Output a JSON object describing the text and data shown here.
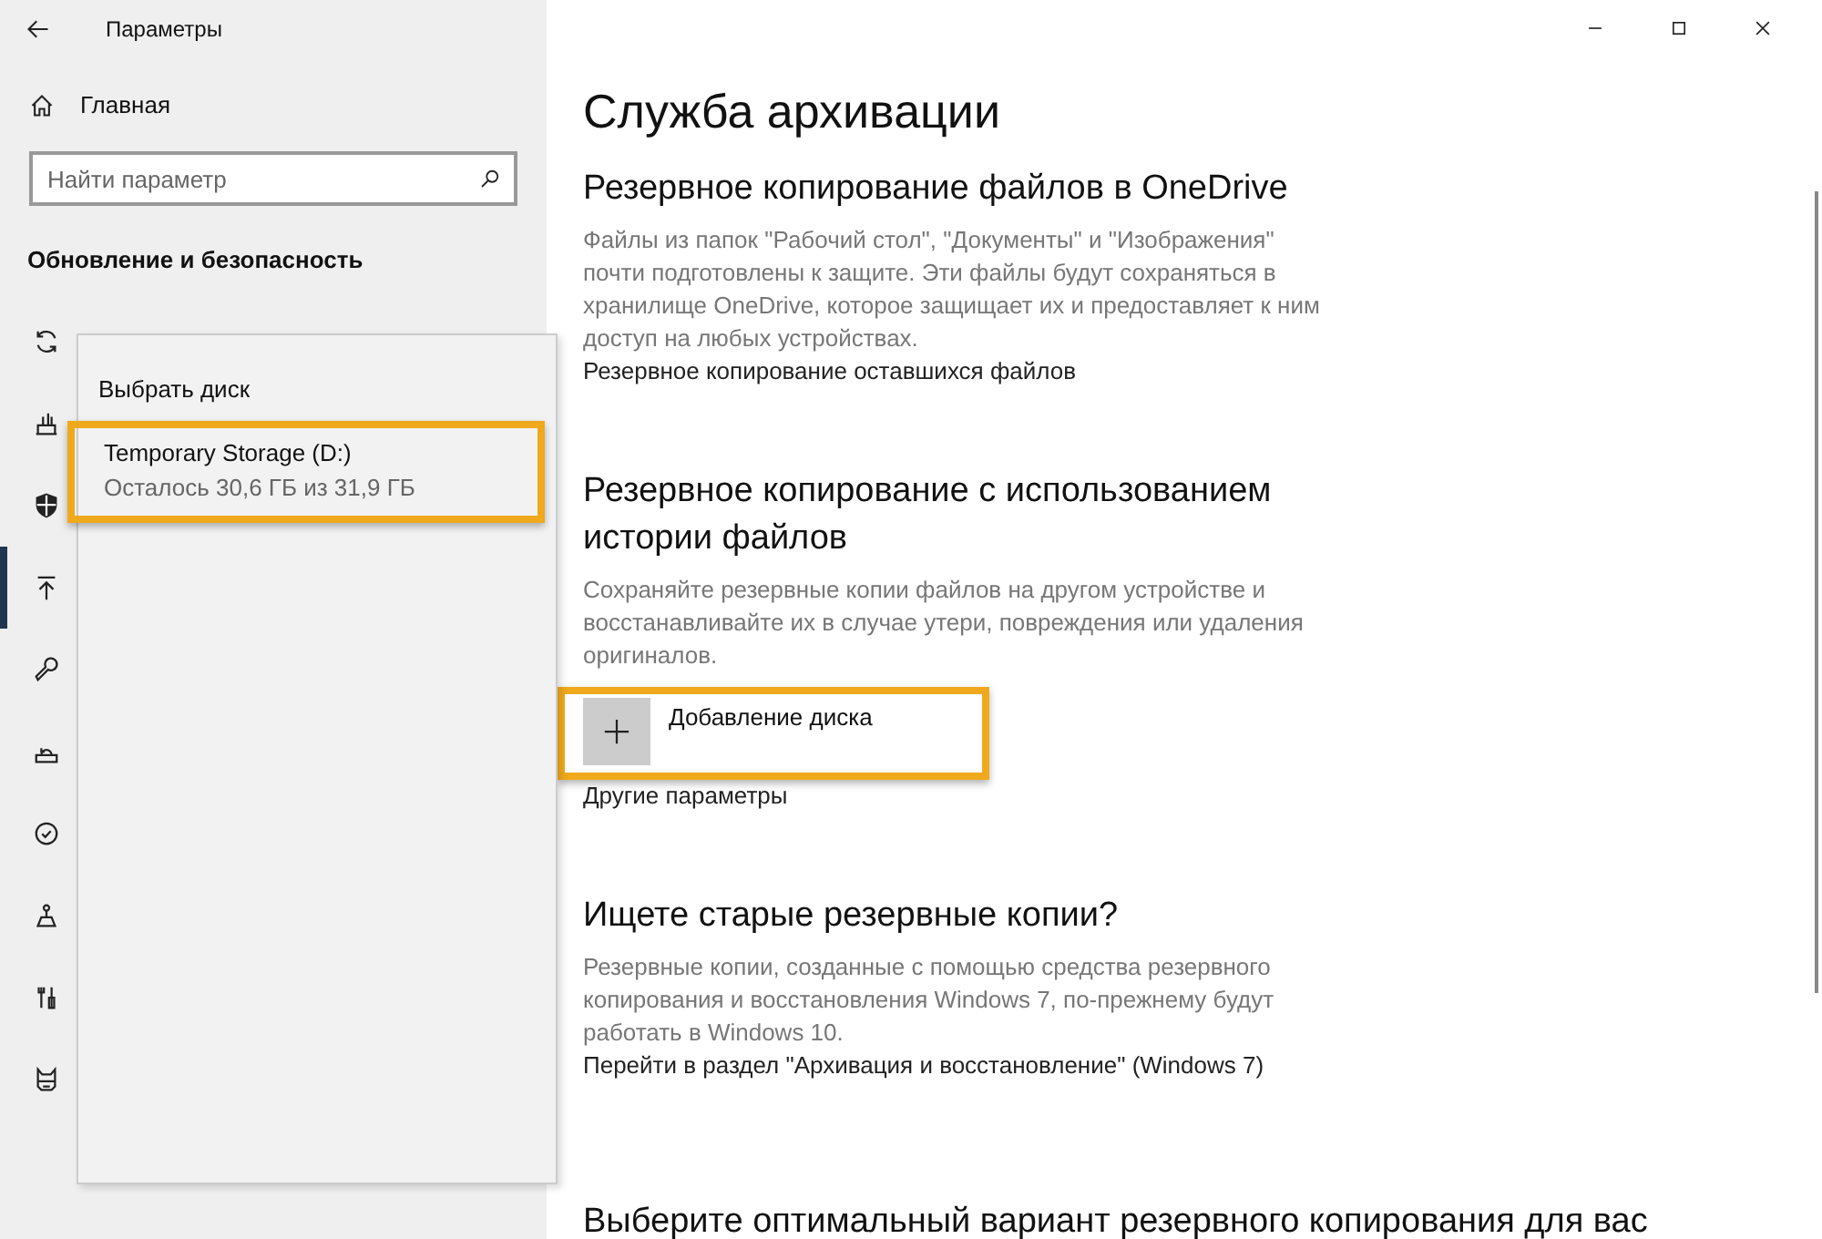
{
  "window": {
    "title": "Параметры"
  },
  "sidebar": {
    "home": "Главная",
    "search": {
      "placeholder": "Найти параметр"
    },
    "section_title": "Обновление и безопасность",
    "items": [
      {
        "selected": false
      },
      {
        "selected": false
      },
      {
        "selected": false
      },
      {
        "selected": true
      },
      {
        "selected": false
      },
      {
        "selected": false
      },
      {
        "selected": false
      },
      {
        "selected": false
      },
      {
        "selected": false
      },
      {
        "selected": false
      }
    ]
  },
  "flyout": {
    "title": "Выбрать диск",
    "drives": [
      {
        "name": "Temporary Storage (D:)",
        "detail": "Осталось 30,6 ГБ из 31,9 ГБ",
        "highlighted": true
      }
    ]
  },
  "main": {
    "title": "Служба архивации",
    "sections": [
      {
        "kind": "text",
        "heading": "Резервное копирование файлов в OneDrive",
        "description": "Файлы из папок \"Рабочий стол\", \"Документы\" и \"Изображения\" почти подготовлены к защите. Эти файлы будут сохраняться в хранилище OneDrive, которое защищает их и предоставляет к ним доступ на любых устройствах.",
        "link": "Резервное копирование оставшихся файлов"
      },
      {
        "kind": "add",
        "heading": "Резервное копирование с использованием истории файлов",
        "description": "Сохраняйте резервные копии файлов на другом устройстве и восстанавливайте их в случае утери, повреждения или удаления оригиналов.",
        "button": {
          "label": "Добавление диска",
          "highlighted": true
        },
        "link": "Другие параметры"
      },
      {
        "kind": "text",
        "heading": "Ищете старые резервные копии?",
        "description": "Резервные копии, созданные с помощью средства резервного копирования и восстановления Windows 7, по-прежнему будут работать в Windows 10.",
        "link": "Перейти в раздел \"Архивация и восстановление\" (Windows 7)"
      },
      {
        "kind": "heading",
        "heading": "Выберите оптимальный вариант резервного копирования для вас"
      }
    ]
  }
}
